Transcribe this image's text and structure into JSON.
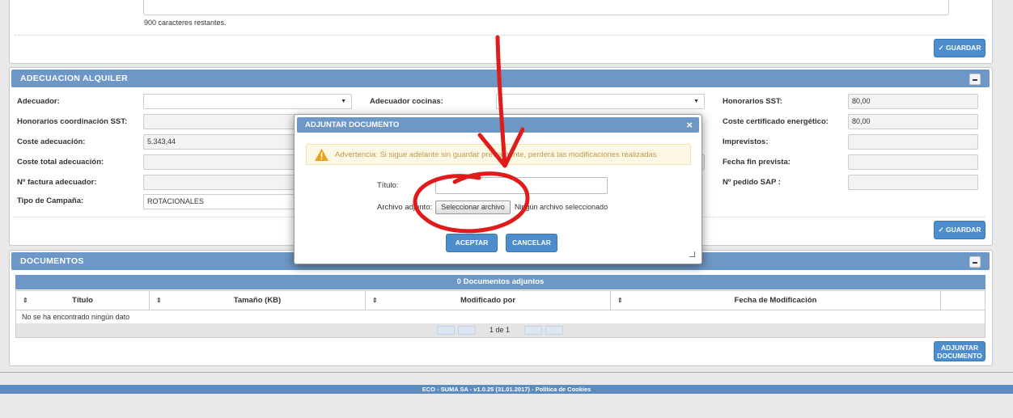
{
  "top": {
    "chars_remaining": "900 caracteres restantes.",
    "save_label": "GUARDAR"
  },
  "adecuacion": {
    "title": "ADECUACION ALQUILER",
    "labels": {
      "adecuador": "Adecuador:",
      "honorarios_coord": "Honorarios coordinación SST:",
      "coste_adecuacion": "Coste adecuación:",
      "coste_total": "Coste total adecuación:",
      "factura": "Nº factura adecuador:",
      "tipo_campana": "Tipo de Campaña:",
      "adecuador_cocinas": "Adecuador cocinas:",
      "honorarios_sst": "Honorarios SST:",
      "coste_certificado": "Coste certificado energético:",
      "imprevistos": "Imprevistos:",
      "fecha_fin": "Fecha fin prevista:",
      "pedido_sap": "Nº pedido SAP :"
    },
    "values": {
      "coste_adecuacion": "5.343,44",
      "tipo_campana": "ROTACIONALES",
      "honorarios_sst": "80,00",
      "coste_certificado": "80,00"
    },
    "save_label": "GUARDAR"
  },
  "documentos": {
    "title": "DOCUMENTOS",
    "count_title": "0 Documentos adjuntos",
    "columns": [
      "Título",
      "Tamaño (KB)",
      "Modificado por",
      "Fecha de Modificación"
    ],
    "empty_text": "No se ha encontrado ningún dato",
    "page_info": "1 de 1",
    "attach_label_1": "ADJUNTAR",
    "attach_label_2": "DOCUMENTO"
  },
  "modal": {
    "title": "ADJUNTAR DOCUMENTO",
    "close": "×",
    "warning": "Advertencia: Si sigue adelante sin guardar previamente, perderá las modificaciones realizadas",
    "titulo_label": "Título:",
    "archivo_label": "Archivo adjunto:",
    "file_button": "Seleccionar archivo",
    "file_status": "Ningún archivo seleccionado",
    "accept": "ACEPTAR",
    "cancel": "CANCELAR"
  },
  "footer": {
    "text": "ECO - SUMA SA - v1.0.25 (31.01.2017) - Política de Cookies"
  },
  "colors": {
    "header_blue": "#6c97c6",
    "button_blue": "#4c8dce",
    "annotation_red": "#e01b1b",
    "warning_bg": "#fcf8e3"
  }
}
